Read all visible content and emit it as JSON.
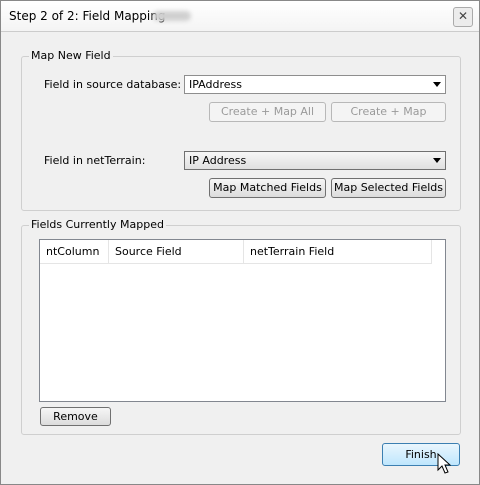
{
  "window": {
    "title": "Step 2 of 2: Field Mapping",
    "close_symbol": "✕"
  },
  "map_new_field": {
    "legend": "Map New Field",
    "source_label": "Field in source database:",
    "source_value": "IPAddress",
    "create_map_all_label": "Create + Map All",
    "create_map_label": "Create + Map",
    "netterrain_label": "Field in netTerrain:",
    "netterrain_value": "IP Address",
    "map_matched_label": "Map Matched Fields",
    "map_selected_label": "Map Selected Fields"
  },
  "fields_mapped": {
    "legend": "Fields Currently Mapped",
    "columns": [
      "ntColumn",
      "Source Field",
      "netTerrain Field"
    ],
    "rows": [],
    "remove_label": "Remove"
  },
  "footer": {
    "finish_label": "Finish"
  },
  "icons": {
    "close": "close-icon",
    "dropdown": "chevron-down-icon",
    "cursor": "mouse-pointer-icon"
  }
}
